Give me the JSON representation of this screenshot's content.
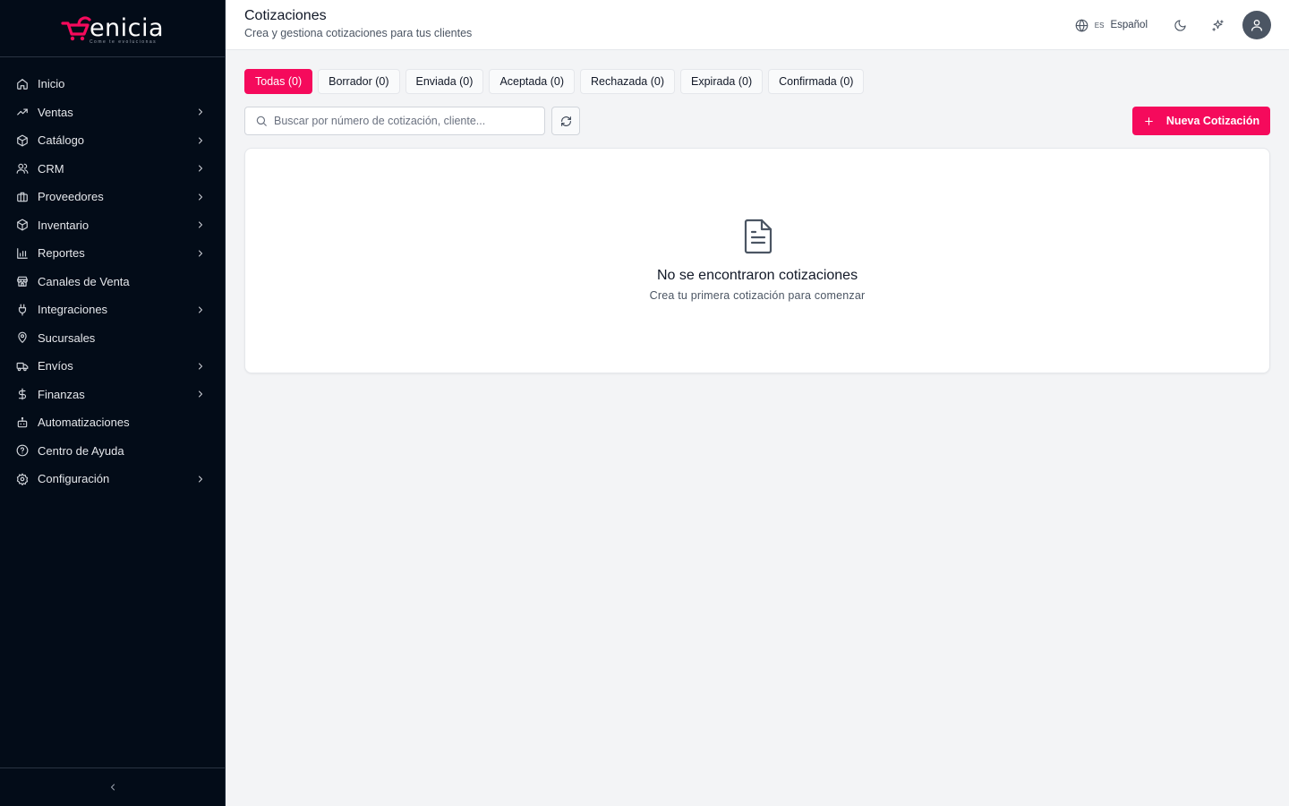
{
  "colors": {
    "accent": "#f50a5c",
    "sidebar_bg": "#030c18",
    "page_bg": "#f3f4f6"
  },
  "brand": {
    "name": "enicia",
    "tagline": "Come te evolucionas"
  },
  "sidebar": {
    "items": [
      {
        "label": "Inicio",
        "icon": "home-icon",
        "expandable": false
      },
      {
        "label": "Ventas",
        "icon": "trending-up-icon",
        "expandable": true
      },
      {
        "label": "Catálogo",
        "icon": "package-icon",
        "expandable": true
      },
      {
        "label": "CRM",
        "icon": "users-icon",
        "expandable": true
      },
      {
        "label": "Proveedores",
        "icon": "briefcase-icon",
        "expandable": true
      },
      {
        "label": "Inventario",
        "icon": "box-icon",
        "expandable": true
      },
      {
        "label": "Reportes",
        "icon": "bar-chart-icon",
        "expandable": true
      },
      {
        "label": "Canales de Venta",
        "icon": "store-icon",
        "expandable": false
      },
      {
        "label": "Integraciones",
        "icon": "plug-icon",
        "expandable": true
      },
      {
        "label": "Sucursales",
        "icon": "map-pin-icon",
        "expandable": false
      },
      {
        "label": "Envíos",
        "icon": "truck-icon",
        "expandable": true
      },
      {
        "label": "Finanzas",
        "icon": "dollar-icon",
        "expandable": true
      },
      {
        "label": "Automatizaciones",
        "icon": "bot-icon",
        "expandable": false
      },
      {
        "label": "Centro de Ayuda",
        "icon": "help-circle-icon",
        "expandable": false
      },
      {
        "label": "Configuración",
        "icon": "settings-icon",
        "expandable": true
      }
    ]
  },
  "header": {
    "title": "Cotizaciones",
    "subtitle": "Crea y gestiona cotizaciones para tus clientes",
    "lang_code": "ES",
    "lang_name": "Español"
  },
  "tabs": [
    {
      "label": "Todas (0)",
      "active": true
    },
    {
      "label": "Borrador (0)",
      "active": false
    },
    {
      "label": "Enviada (0)",
      "active": false
    },
    {
      "label": "Aceptada (0)",
      "active": false
    },
    {
      "label": "Rechazada (0)",
      "active": false
    },
    {
      "label": "Expirada (0)",
      "active": false
    },
    {
      "label": "Confirmada (0)",
      "active": false
    }
  ],
  "search": {
    "placeholder": "Buscar por número de cotización, cliente...",
    "value": ""
  },
  "actions": {
    "new_label": "Nueva Cotización"
  },
  "empty": {
    "title": "No se encontraron cotizaciones",
    "subtitle": "Crea tu primera cotización para comenzar"
  }
}
